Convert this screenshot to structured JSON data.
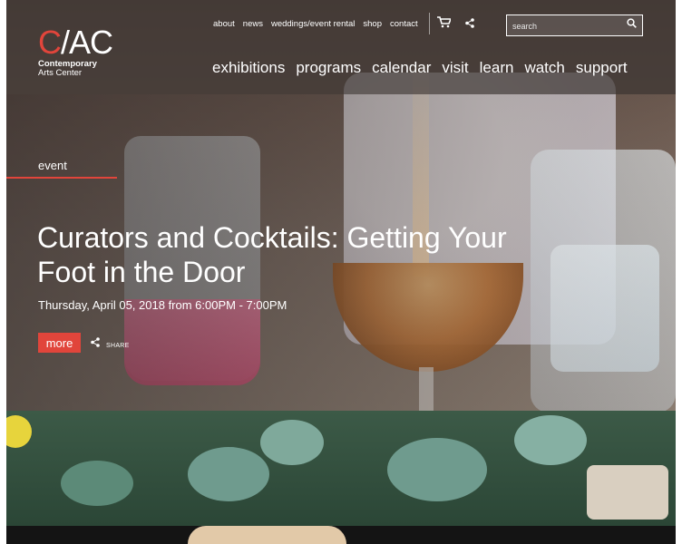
{
  "brand": {
    "mark_c": "C",
    "mark_rest": "/AC",
    "line1": "Contemporary",
    "line2": "Arts Center",
    "accent": "#e1453b"
  },
  "utility_nav": [
    "about",
    "news",
    "weddings/event rental",
    "shop",
    "contact"
  ],
  "utility_icons": [
    "cart-icon",
    "share-icon"
  ],
  "search": {
    "placeholder": "search",
    "icon": "search-icon"
  },
  "main_nav": [
    "exhibitions",
    "programs",
    "calendar",
    "visit",
    "learn",
    "watch",
    "support"
  ],
  "feature": {
    "tag": "event",
    "title": "Curators and Cocktails: Getting Your Foot in the Door",
    "date": "Thursday, April 05, 2018 from 6:00PM - 7:00PM",
    "more_label": "more",
    "share_label": "SHARE"
  }
}
